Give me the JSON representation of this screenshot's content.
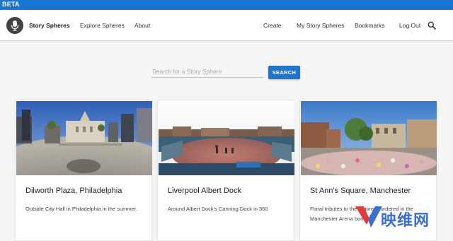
{
  "beta_label": "BETA",
  "header": {
    "brand": "Story Spheres",
    "nav_left": [
      "Explore Spheres",
      "About"
    ],
    "nav_right": [
      "Create",
      "My Story Spheres",
      "Bookmarks",
      "Log Out"
    ],
    "logo_icon": "microphone-icon",
    "search_icon": "search-icon"
  },
  "search": {
    "placeholder": "Search for a Story Sphere",
    "value": "",
    "button_label": "SEARCH"
  },
  "cards": [
    {
      "title": "Dilworth Plaza, Philadelphia",
      "description": "Outside City Hall in Philadelphia in the summer."
    },
    {
      "title": "Liverpool Albert Dock",
      "description": "Around Albert Dock's Canning Dock in 360"
    },
    {
      "title": "St Ann's Square, Manchester",
      "description": "Floral tributes to the victims murdered in the Manchester Arena bombing."
    }
  ],
  "watermark": {
    "text": "映维网"
  },
  "colors": {
    "accent": "#1976d2",
    "header_bg": "#ffffff",
    "page_bg": "#f5f5f5"
  }
}
